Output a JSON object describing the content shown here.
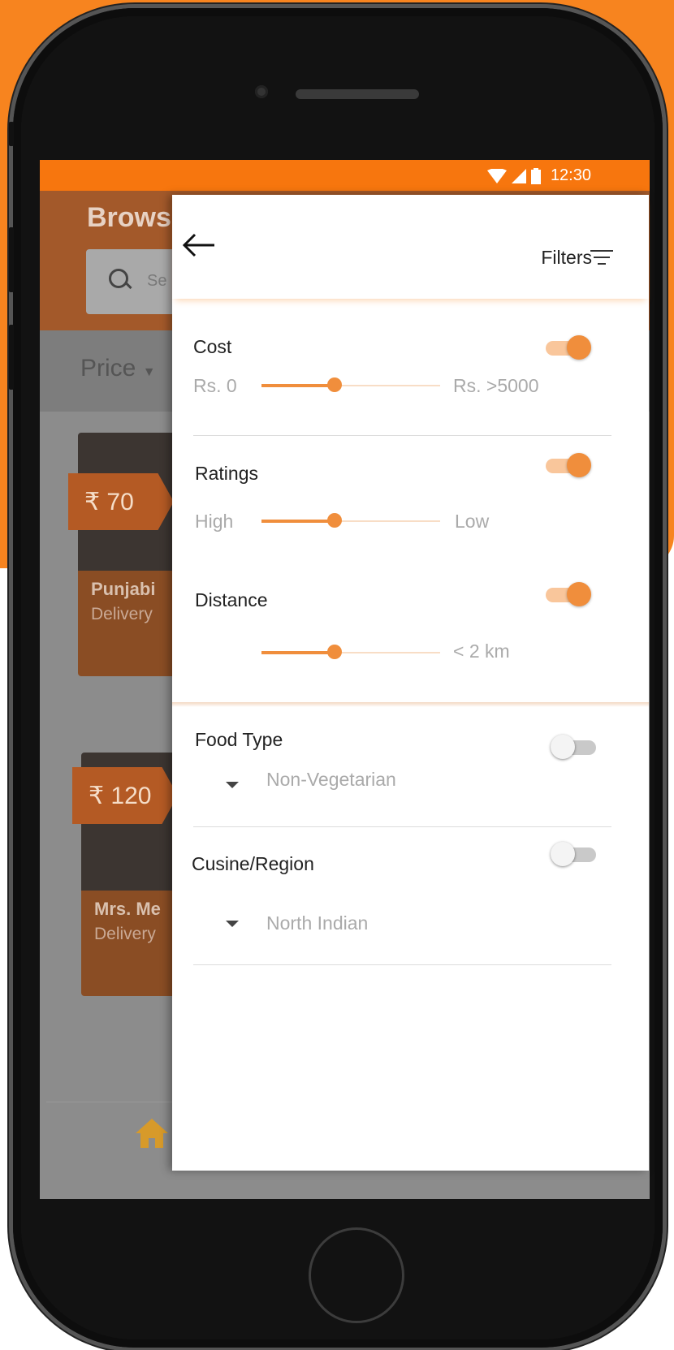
{
  "status_bar": {
    "time": "12:30",
    "icons": [
      "wifi-icon",
      "cell-signal-icon",
      "battery-icon"
    ]
  },
  "background": {
    "title": "Brows",
    "search_placeholder": "Se",
    "sort_label": "Price",
    "cards": [
      {
        "price": "₹ 70",
        "name": "Punjabi",
        "sub": "Delivery"
      },
      {
        "price": "₹ 120",
        "name": "Mrs. Me",
        "sub": "Delivery"
      }
    ]
  },
  "filters": {
    "title": "Filters",
    "cost": {
      "label": "Cost",
      "min_label": "Rs. 0",
      "max_label": "Rs. >5000",
      "enabled": true,
      "level": 0.41
    },
    "ratings": {
      "label": "Ratings",
      "min_label": "High",
      "max_label": "Low",
      "enabled": true,
      "level": 0.41
    },
    "distance": {
      "label": "Distance",
      "max_label": "< 2 km",
      "enabled": true,
      "level": 0.41
    },
    "food_type": {
      "label": "Food Type",
      "value": "Non-Vegetarian",
      "enabled": false
    },
    "cuisine": {
      "label": "Cusine/Region",
      "value": "North Indian",
      "enabled": false
    }
  },
  "colors": {
    "accent": "#f7760e",
    "slider": "#f08e3c",
    "overlay": "#8c8c8c"
  }
}
